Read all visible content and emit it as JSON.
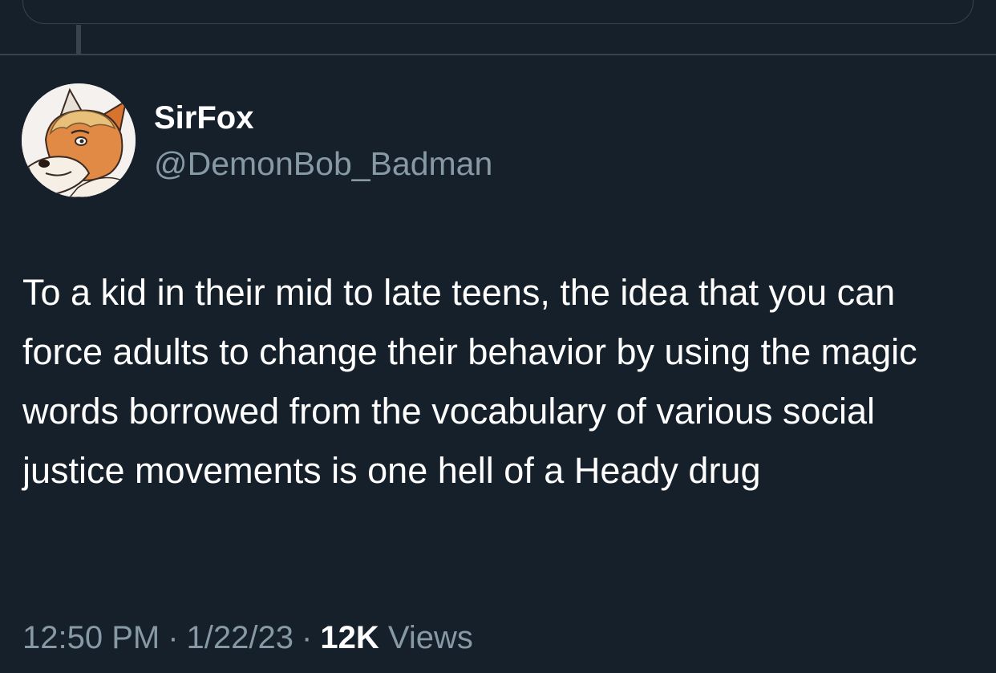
{
  "tweet": {
    "author": {
      "display_name": "SirFox",
      "handle": "@DemonBob_Badman",
      "avatar_icon": "fox-avatar"
    },
    "text": "To a kid in their mid to late teens, the idea that you can force adults to change their behavior by using the magic words borrowed from the vocabulary of various social justice movements is one hell of a Heady drug",
    "time": "12:50 PM",
    "date": "1/22/23",
    "separator": "·",
    "views_count": "12K",
    "views_label": "Views"
  },
  "colors": {
    "background": "#15202b",
    "border": "#38444d",
    "primary_text": "#ffffff",
    "secondary_text": "#8899a6"
  }
}
